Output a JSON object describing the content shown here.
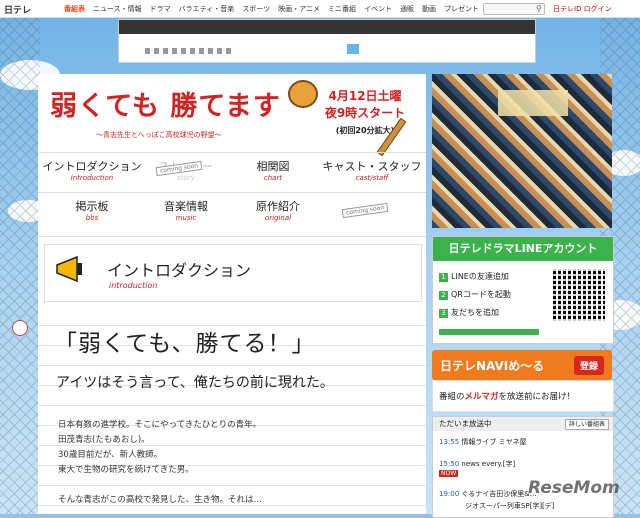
{
  "topnav": {
    "logo": "日テレ",
    "links": [
      "番組表",
      "ニュース・情報",
      "ドラマ",
      "バラエティ・音楽",
      "スポーツ",
      "映画・アニメ",
      "ミニ番組",
      "イベント",
      "通販",
      "動画",
      "プレゼント"
    ],
    "current_index": 0,
    "search_icon": "search-icon",
    "login": "日テレID ログイン"
  },
  "show": {
    "title": "弱くても 勝てます",
    "subtitle": "～青志先生とへっぽこ高校球児の野望～",
    "date_line1": "4月12日土曜",
    "date_line2": "夜9時スタート",
    "date_line3": "(初回20分拡大)"
  },
  "menu": {
    "items": [
      {
        "label": "イントロダクション",
        "en": "introduction"
      },
      {
        "label": "ストーリー",
        "en": "story"
      },
      {
        "label": "相関図",
        "en": "chart"
      },
      {
        "label": "キャスト・スタッフ",
        "en": "cast/staff"
      },
      {
        "label": "掲示板",
        "en": "bbs"
      },
      {
        "label": "音楽情報",
        "en": "music"
      },
      {
        "label": "原作紹介",
        "en": "original"
      }
    ],
    "coming_soon": "coming soon"
  },
  "section": {
    "title": "イントロダクション",
    "subtitle": "introduction"
  },
  "intro": {
    "quote": "「弱くても、勝てる！」",
    "lead": "アイツはそう言って、俺たちの前に現れた。",
    "lines": [
      "日本有数の進学校。そこにやってきたひとりの青年。",
      "田茂青志(たもあおし)。",
      "30歳目前だが、新人教師。",
      "東大で生物の研究を続けてきた男。",
      "",
      "そんな青志がこの高校で発見した、生き物。それは…"
    ]
  },
  "sidebar": {
    "line": {
      "header": "日テレドラマLINEアカウント",
      "steps": [
        "LINEの友達追加",
        "QRコードを起動",
        "友だちを追加"
      ]
    },
    "navi": {
      "title": "日テレNAVIめ～る",
      "register": "登録"
    },
    "mail": {
      "prefix": "番組の",
      "highlight": "メルマガ",
      "suffix": "を放送前にお届け！"
    },
    "onair": {
      "header": "ただいま放送中",
      "more": "詳しい番組表",
      "rows": [
        {
          "time": "13:55",
          "title": "情報ライブ ミヤネ屋"
        },
        {
          "time": "15:50",
          "title": "news every.[字]"
        },
        {
          "time": "19:00",
          "title": "ぐるナイ吉田沙保里&…"
        },
        {
          "time": "",
          "title": "ジオスーパー列車SP[字][デ]"
        }
      ],
      "now": "NOW"
    }
  },
  "watermark": "ReseMom",
  "colors": {
    "accent": "#d32222",
    "line_green": "#3bb24a",
    "navi_orange": "#f07a1e"
  }
}
